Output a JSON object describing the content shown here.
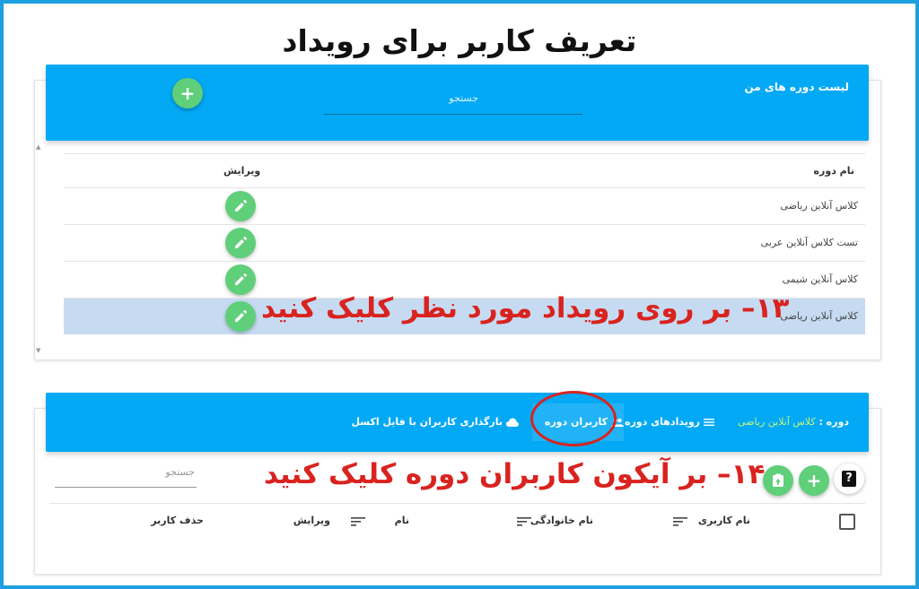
{
  "page_title": "تعریف کاربر برای رویداد",
  "courses_panel": {
    "title": "لیست دوره های من",
    "search_placeholder": "جستجو",
    "add_icon": "plus-icon",
    "columns": {
      "name": "نام دوره",
      "edit": "ویرایش"
    },
    "rows": [
      {
        "name": "کلاس آنلاین ریاضی"
      },
      {
        "name": "تست کلاس آنلاین عربی"
      },
      {
        "name": "کلاس آنلاین شیمی"
      },
      {
        "name": "کلاس آنلاین ریاضی"
      }
    ],
    "edit_icon": "pencil-icon"
  },
  "annotations": {
    "step13": "۱۳– بر روی رویداد مورد نظر کلیک کنید",
    "step14": "۱۴– بر آیکون کاربران دوره کلیک کنید"
  },
  "course_panel": {
    "course_label": "دوره :",
    "course_name": "کلاس آنلاین ریاضی",
    "tabs": {
      "events": "رویدادهای دوره",
      "users": "کاربران دوره",
      "upload": "بارگذاری کاربران با فایل اکسل"
    },
    "search_placeholder": "جستجو",
    "columns": {
      "username": "نام کاربری",
      "lastname": "نام خانوادگی",
      "firstname": "نام",
      "edit": "ویرایش",
      "delete": "حذف کاربر"
    }
  },
  "colors": {
    "primary": "#03a9f4",
    "accent_green": "#5fcf7a",
    "annotation_red": "#d9231f",
    "frame_blue": "#1e9fe0",
    "selected_row": "#c6dbf2"
  }
}
